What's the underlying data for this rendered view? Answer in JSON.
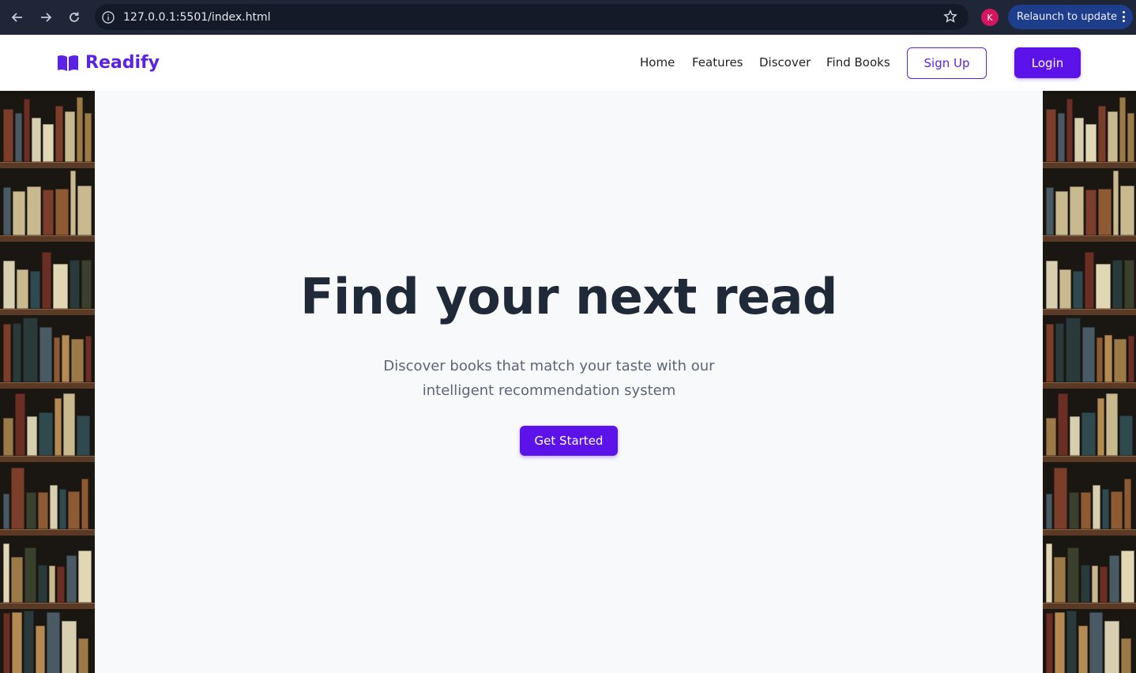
{
  "browser": {
    "url": "127.0.0.1:5501/index.html",
    "profile_initial": "K",
    "relaunch_label": "Relaunch to update"
  },
  "site": {
    "brand": "Readify",
    "nav": [
      "Home",
      "Features",
      "Discover",
      "Find Books"
    ],
    "signup_label": "Sign Up",
    "login_label": "Login",
    "accent_color": "#5b13ea"
  },
  "hero": {
    "title": "Find your next read",
    "subtitle": "Discover books that match your taste with our intelligent recommendation system",
    "cta_label": "Get Started"
  }
}
